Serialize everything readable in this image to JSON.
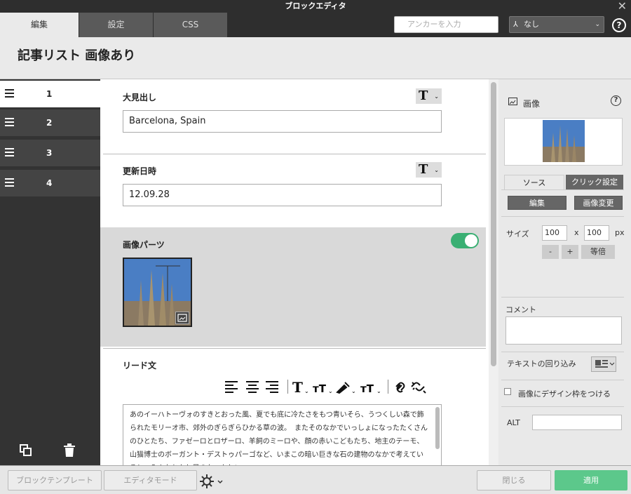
{
  "window": {
    "title": "ブロックエディタ",
    "close_glyph": "✕"
  },
  "tabs": [
    {
      "label": "編集",
      "active": true
    },
    {
      "label": "設定"
    },
    {
      "label": "CSS"
    }
  ],
  "anchor": {
    "hash": "#",
    "placeholder": "アンカーを入力"
  },
  "style_select": {
    "icon": "⅄",
    "value": "なし",
    "chevron": "⌄"
  },
  "help_top": "?",
  "page": {
    "title": "記事リスト 画像あり"
  },
  "left_items": [
    {
      "num": "1",
      "active": true
    },
    {
      "num": "2"
    },
    {
      "num": "3"
    },
    {
      "num": "4"
    }
  ],
  "fields": {
    "heading": {
      "label": "大見出し",
      "value": "Barcelona, Spain"
    },
    "updated": {
      "label": "更新日時",
      "value": "12.09.28"
    },
    "image_part": {
      "label": "画像パーツ",
      "toggle_on": true
    },
    "lead": {
      "label": "リード文",
      "text": "あのイーハトーヴォのすきとおった風、夏でも底に冷たさをもつ青いそら、うつくしい森で飾られたモリーオ市、郊外のぎらぎらひかる草の波。　またそのなかでいっしょになったたくさんのひとたち、ファゼーロとロザーロ、羊飼のミーロや、顔の赤いこどもたち、地主のテーモ、山猫博士のボーガント・デストゥパーゴなど、いまこの暗い巨きな石の建物のなかで考えていると、みんなむかし風のなつかしい"
    }
  },
  "t_button": {
    "glyph": "T",
    "chevron": "⌄"
  },
  "right": {
    "section_title": "画像",
    "help": "?",
    "tabs": [
      "ソース",
      "クリック設定"
    ],
    "edit_btn": "編集",
    "change_btn": "画像変更",
    "size_label": "サイズ",
    "width": "100",
    "x": "x",
    "height": "100",
    "unit": "px",
    "minus": "-",
    "plus": "+",
    "equal": "等倍",
    "comment_label": "コメント",
    "wrap_label": "テキストの回り込み",
    "frame_label": "画像にデザイン枠をつける",
    "alt_label": "ALT"
  },
  "footer": {
    "template": "ブロックテンプレート",
    "editor_mode": "エディタモード",
    "close": "閉じる",
    "apply": "適用"
  },
  "colors": {
    "toggle": "#3aaf73",
    "apply": "#5cc88b",
    "dark": "#2e2e2e"
  }
}
